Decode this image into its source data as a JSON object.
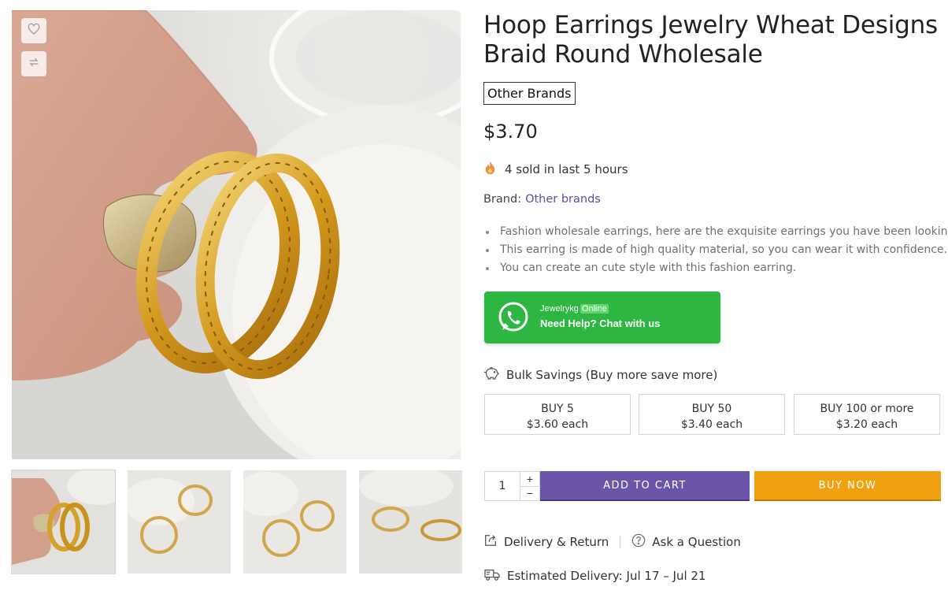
{
  "product": {
    "title": "Hoop Earrings Jewelry Wheat Designs Braid Round Wholesale",
    "brand_tag": "Other Brands",
    "price": "$3.70",
    "sold_text": "4 sold in last 5 hours",
    "brand_label": "Brand:",
    "brand_link": "Other brands",
    "features": [
      "Fashion wholesale earrings, here are the exquisite earrings you have been looking for.",
      "This earring is made of high quality material, so you can wear it with confidence.",
      "You can create an cute style with this fashion earring."
    ]
  },
  "whatsapp": {
    "name": "Jewelrykg",
    "status": "Online",
    "help": "Need Help? Chat with us",
    "color": "#2db742"
  },
  "bulk": {
    "heading": "Bulk Savings (Buy more save more)",
    "tiers": [
      {
        "label": "BUY 5",
        "price": "$3.60 each"
      },
      {
        "label": "BUY 50",
        "price": "$3.40 each"
      },
      {
        "label": "BUY 100 or more",
        "price": "$3.20 each"
      }
    ]
  },
  "cart": {
    "quantity": "1",
    "plus": "+",
    "minus": "−",
    "add_to_cart": "ADD TO CART",
    "buy_now": "BUY NOW",
    "add_color": "#6a55a8",
    "buy_color": "#f0a10f"
  },
  "links": {
    "delivery_return": "Delivery & Return",
    "ask_question": "Ask a Question",
    "estimated_delivery": "Estimated Delivery: Jul 17 – Jul 21"
  },
  "icons": {
    "wishlist": "heart-icon",
    "compare": "compare-arrows-icon",
    "fire": "fire-icon",
    "whatsapp": "whatsapp-icon",
    "bulk": "piggy-bank-icon",
    "delivery_return": "share-box-icon",
    "question": "question-circle-icon",
    "truck": "truck-icon"
  }
}
